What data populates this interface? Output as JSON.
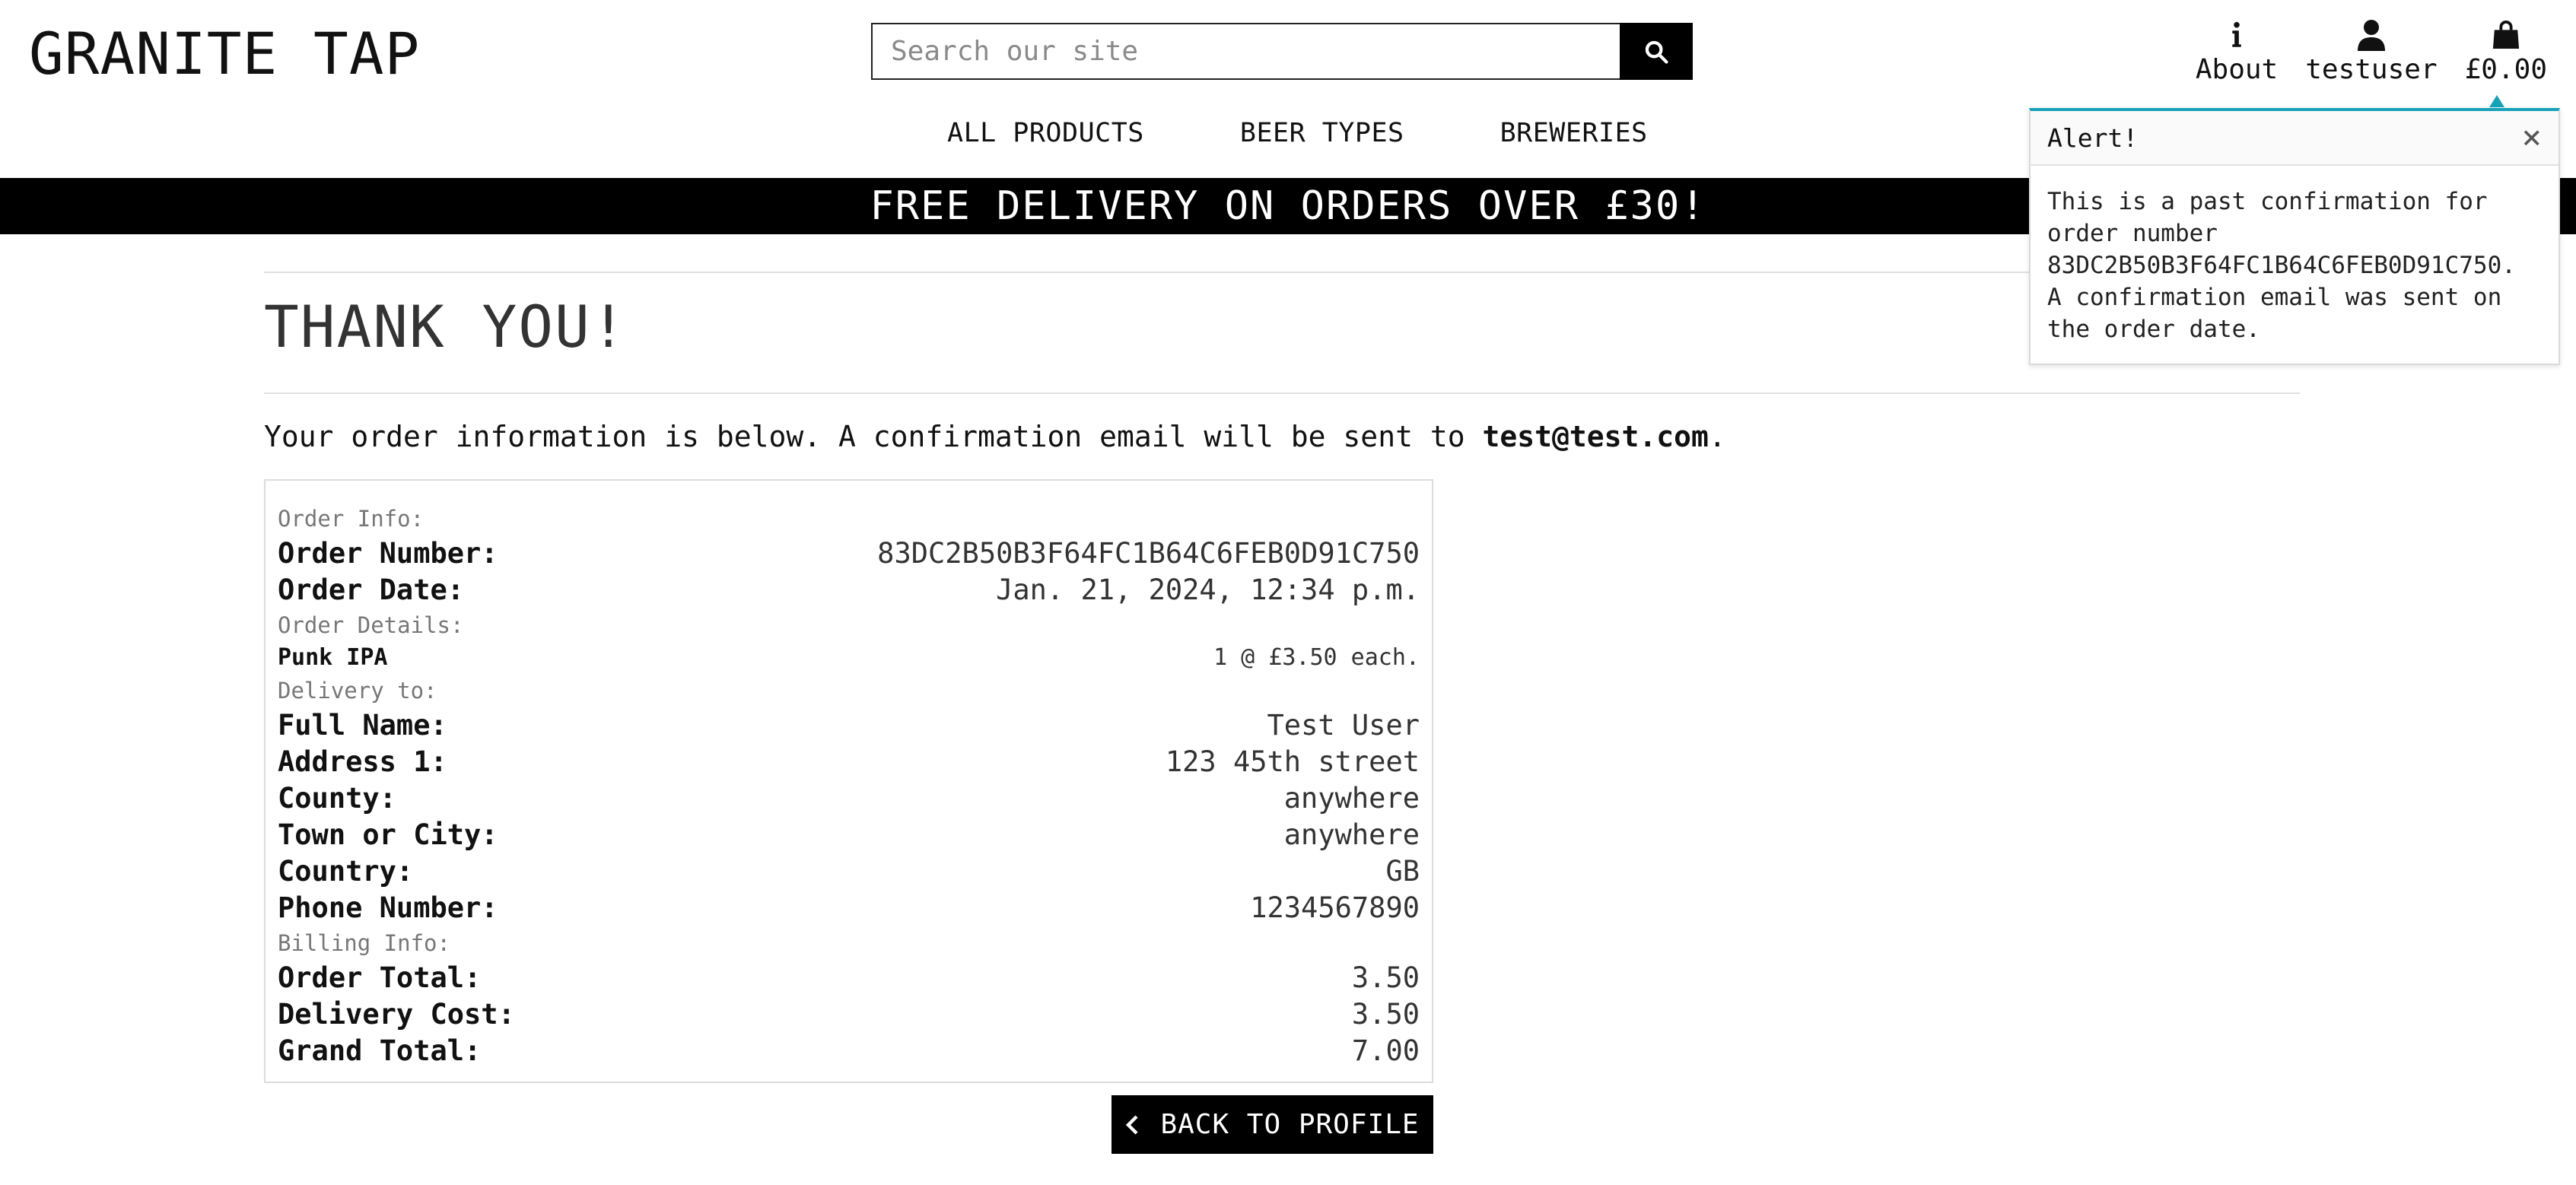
{
  "header": {
    "logo": "GRANITE TAP",
    "search_placeholder": "Search our site",
    "links": {
      "about": "About",
      "account": "testuser",
      "bag": "£0.00"
    }
  },
  "nav": {
    "items": [
      "ALL PRODUCTS",
      "BEER TYPES",
      "BREWERIES"
    ]
  },
  "banner": "FREE DELIVERY ON ORDERS OVER £30!",
  "main": {
    "title": "THANK YOU!",
    "intro_prefix": "Your order information is below. A confirmation email will be sent to ",
    "email": "test@test.com",
    "intro_suffix": ".",
    "order": {
      "order_info_label": "Order Info:",
      "order_number_label": "Order Number:",
      "order_number": "83DC2B50B3F64FC1B64C6FEB0D91C750",
      "order_date_label": "Order Date:",
      "order_date": "Jan. 21, 2024, 12:34 p.m.",
      "order_details_label": "Order Details:",
      "item_name": "Punk IPA",
      "item_qty": "1 @ £3.50 each.",
      "delivery_label": "Delivery to:",
      "full_name_label": "Full Name:",
      "full_name": "Test User",
      "address1_label": "Address 1:",
      "address1": "123 45th street",
      "county_label": "County:",
      "county": "anywhere",
      "town_label": "Town or City:",
      "town": "anywhere",
      "country_label": "Country:",
      "country": "GB",
      "phone_label": "Phone Number:",
      "phone": "1234567890",
      "billing_label": "Billing Info:",
      "order_total_label": "Order Total:",
      "order_total": "3.50",
      "delivery_cost_label": "Delivery Cost:",
      "delivery_cost": "3.50",
      "grand_total_label": "Grand Total:",
      "grand_total": "7.00"
    },
    "back_button": "BACK TO PROFILE"
  },
  "alert": {
    "title": "Alert!",
    "close": "×",
    "body": "This is a past confirmation for order number 83DC2B50B3F64FC1B64C6FEB0D91C750. A confirmation email was sent on the order date."
  },
  "icons": {
    "search": "search-icon",
    "about": "info-icon",
    "account": "user-icon",
    "bag": "shopping-bag-icon",
    "back": "chevron-left-icon"
  },
  "colors": {
    "accent": "#17a2b8",
    "banner_bg": "#000000",
    "button_bg": "#000000"
  }
}
